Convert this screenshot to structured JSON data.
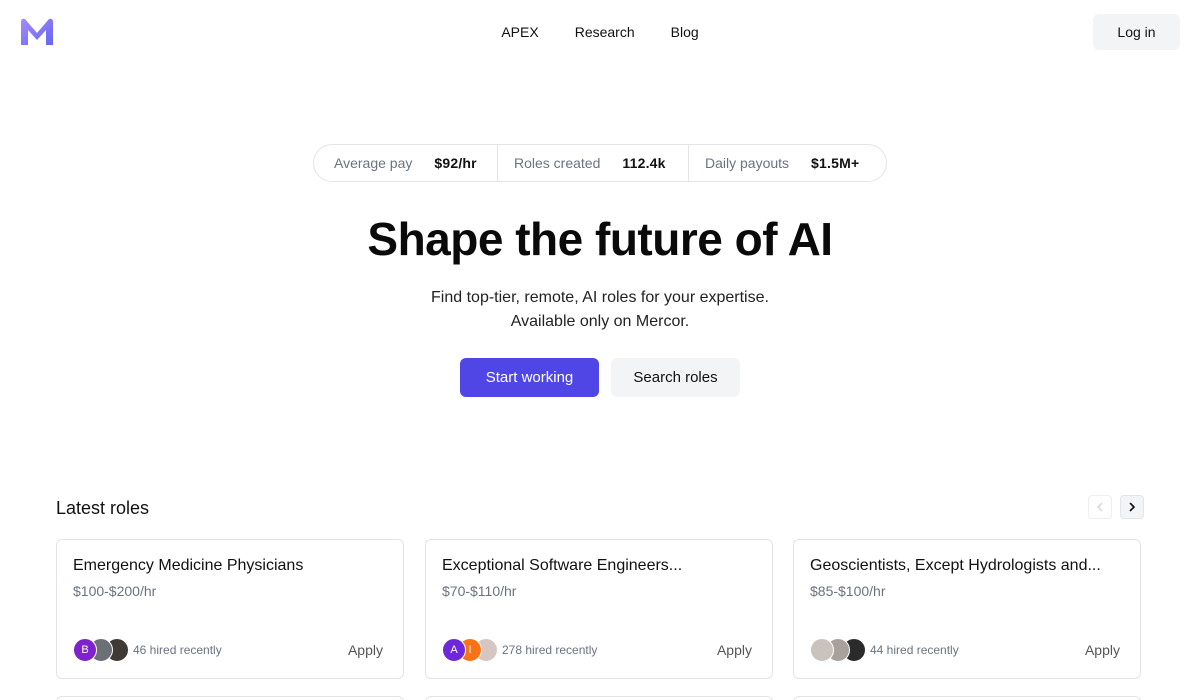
{
  "header": {
    "logo_icon": "mercor-m-logo",
    "nav": [
      "APEX",
      "Research",
      "Blog"
    ],
    "login_label": "Log in"
  },
  "stats": [
    {
      "label": "Average pay",
      "value": "$92/hr"
    },
    {
      "label": "Roles created",
      "value": "112.4k"
    },
    {
      "label": "Daily payouts",
      "value": "$1.5M+"
    }
  ],
  "hero": {
    "title": "Shape the future of AI",
    "subtitle_line1": "Find top-tier, remote, AI roles for your expertise.",
    "subtitle_line2": "Available only on Mercor.",
    "primary_cta": "Start working",
    "secondary_cta": "Search roles"
  },
  "roles": {
    "title": "Latest roles",
    "prev_icon": "chevron-left-icon",
    "next_icon": "chevron-right-icon",
    "cards": [
      {
        "title": "Emergency Medicine Physicians",
        "pay": "$100-$200/hr",
        "hired": "46 hired recently",
        "apply": "Apply",
        "avatars": [
          {
            "initial": "B",
            "color": "#7e22ce"
          },
          {
            "initial": "",
            "color": "#6b6f76"
          },
          {
            "initial": "",
            "color": "#3f3a36"
          }
        ]
      },
      {
        "title": "Exceptional Software Engineers...",
        "pay": "$70-$110/hr",
        "hired": "278 hired recently",
        "apply": "Apply",
        "avatars": [
          {
            "initial": "A",
            "color": "#6d28d9"
          },
          {
            "initial": "I",
            "color": "#f97316"
          },
          {
            "initial": "",
            "color": "#d6c6c2"
          }
        ]
      },
      {
        "title": "Geoscientists, Except Hydrologists and...",
        "pay": "$85-$100/hr",
        "hired": "44 hired recently",
        "apply": "Apply",
        "avatars": [
          {
            "initial": "",
            "color": "#c9c2bd"
          },
          {
            "initial": "",
            "color": "#a8a19b"
          },
          {
            "initial": "",
            "color": "#2b2b2b"
          }
        ]
      }
    ]
  },
  "colors": {
    "accent": "#4f46e5",
    "logo_gradient_start": "#8b5cf6",
    "logo_gradient_end": "#6366f1"
  }
}
